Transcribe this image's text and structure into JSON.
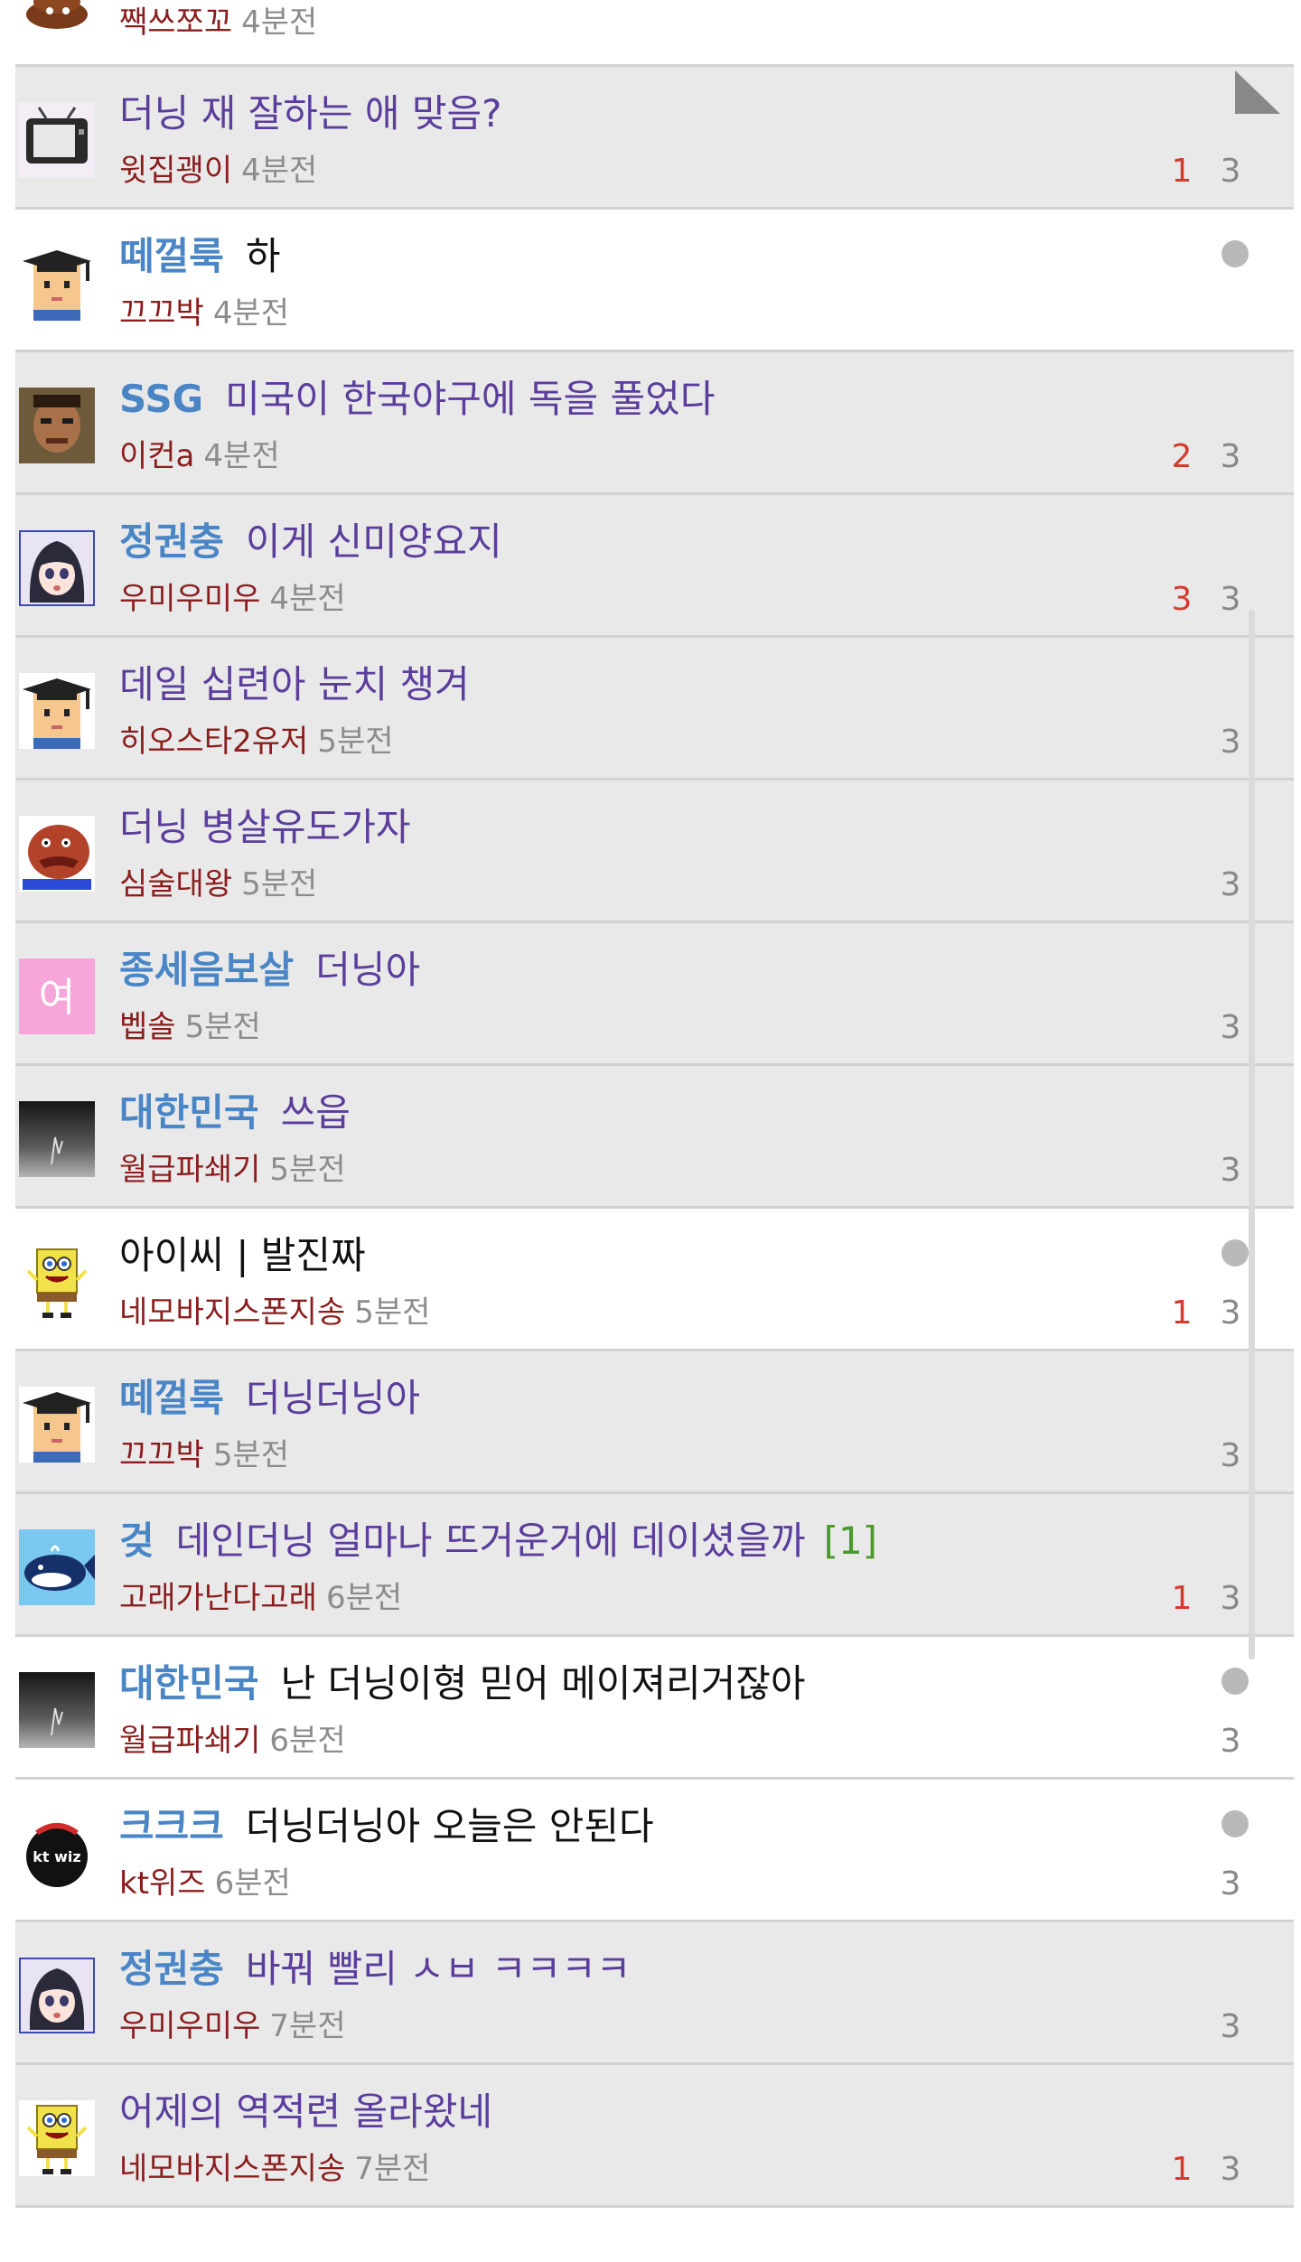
{
  "rows": [
    {
      "title_cat": "",
      "title": "",
      "comments": "",
      "author": "짹쓰쪼꼬",
      "time": "4분전",
      "recommend": "",
      "views": "",
      "read": true,
      "avatar": "poop-icon"
    },
    {
      "title_cat": "",
      "title": "더닝 재 잘하는 애 맞음?",
      "comments": "",
      "author": "윗집괭이",
      "time": "4분전",
      "recommend": "1",
      "views": "3",
      "read": false,
      "avatar": "tv-icon"
    },
    {
      "title_cat": "떼껄룩",
      "title": "하",
      "comments": "",
      "author": "끄끄박",
      "time": "4분전",
      "recommend": "",
      "views": "",
      "read": true,
      "avatar": "graduate-icon"
    },
    {
      "title_cat": "SSG",
      "title": "미국이 한국야구에 독을 풀었다",
      "comments": "",
      "author": "이컨a",
      "time": "4분전",
      "recommend": "2",
      "views": "3",
      "read": false,
      "avatar": "fighter-icon"
    },
    {
      "title_cat": "정권충",
      "title": "이게 신미양요지",
      "comments": "",
      "author": "우미우미우",
      "time": "4분전",
      "recommend": "3",
      "views": "3",
      "read": false,
      "avatar": "anime-girl-icon"
    },
    {
      "title_cat": "",
      "title": "데일 십련아 눈치 챙겨",
      "comments": "",
      "author": "히오스타2유저",
      "time": "5분전",
      "recommend": "",
      "views": "3",
      "read": false,
      "avatar": "graduate-icon"
    },
    {
      "title_cat": "",
      "title": "더닝 병살유도가자",
      "comments": "",
      "author": "심술대왕",
      "time": "5분전",
      "recommend": "",
      "views": "3",
      "read": false,
      "avatar": "creature-icon"
    },
    {
      "title_cat": "종세음보살",
      "title": "더닝아",
      "comments": "",
      "author": "벱솔",
      "time": "5분전",
      "recommend": "",
      "views": "3",
      "read": false,
      "avatar": "pink-letter-icon",
      "avatar_text": "여"
    },
    {
      "title_cat": "대한민국",
      "title": "쓰읍",
      "comments": "",
      "author": "월급파쇄기",
      "time": "5분전",
      "recommend": "",
      "views": "3",
      "read": false,
      "avatar": "dark-photo-icon"
    },
    {
      "title_cat": "",
      "title": "아이씨 | 발진짜",
      "comments": "",
      "author": "네모바지스폰지송",
      "time": "5분전",
      "recommend": "1",
      "views": "3",
      "read": true,
      "avatar": "sponge-icon"
    },
    {
      "title_cat": "떼껄룩",
      "title": "더닝더닝아",
      "comments": "",
      "author": "끄끄박",
      "time": "5분전",
      "recommend": "",
      "views": "3",
      "read": false,
      "avatar": "graduate-icon"
    },
    {
      "title_cat": "겆",
      "title": "데인더닝 얼마나 뜨거운거에 데이셨을까",
      "comments": "[1]",
      "author": "고래가난다고래",
      "time": "6분전",
      "recommend": "1",
      "views": "3",
      "read": false,
      "avatar": "whale-icon"
    },
    {
      "title_cat": "대한민국",
      "title": "난 더닝이형 믿어 메이져리거잖아",
      "comments": "",
      "author": "월급파쇄기",
      "time": "6분전",
      "recommend": "",
      "views": "3",
      "read": true,
      "avatar": "dark-photo-icon"
    },
    {
      "title_cat": "크크크",
      "title": "더닝더닝아 오늘은 안된다",
      "comments": "",
      "author": "kt위즈",
      "time": "6분전",
      "recommend": "",
      "views": "3",
      "read": true,
      "avatar": "ktwiz-logo-icon",
      "avatar_text": "kt wiz"
    },
    {
      "title_cat": "정권충",
      "title": "바꿔 빨리 ㅅㅂ ㅋㅋㅋㅋ",
      "comments": "",
      "author": "우미우미우",
      "time": "7분전",
      "recommend": "",
      "views": "3",
      "read": false,
      "avatar": "anime-girl-icon"
    },
    {
      "title_cat": "",
      "title": "어제의 역적련 올라왔네",
      "comments": "",
      "author": "네모바지스폰지송",
      "time": "7분전",
      "recommend": "1",
      "views": "3",
      "read": false,
      "avatar": "sponge-icon"
    }
  ],
  "colors": {
    "category": "#4a86c5",
    "title_unread": "#5b3d9c",
    "title_read": "#111111",
    "author": "#8a1d1d",
    "time": "#8c8c8c",
    "recommend": "#d43b2e",
    "comments": "#4a9a2a",
    "row_unread_bg": "#e9e9e9",
    "row_read_bg": "#ffffff"
  }
}
